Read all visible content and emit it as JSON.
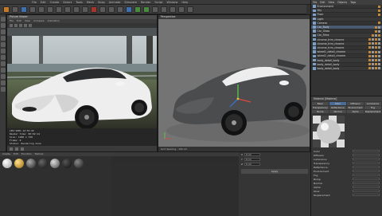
{
  "app": {
    "title": "CINEMA 4D"
  },
  "menubar": {
    "items": [
      "File",
      "Edit",
      "Create",
      "Select",
      "Tools",
      "Mesh",
      "Snap",
      "Animate",
      "Simulate",
      "Render",
      "Script",
      "Window",
      "Help"
    ]
  },
  "render_window": {
    "title": "Picture Viewer",
    "menu": [
      "File",
      "Edit",
      "View",
      "Compare",
      "Animation"
    ],
    "info_lines": [
      "CPU:100%  12:35:22",
      "Render time: 00:02:14",
      "Size: 1280 x 720",
      "Frame: 0",
      "Status: Rendering done"
    ]
  },
  "viewport": {
    "title": "Perspective",
    "footer": "Grid Spacing : 100 cm"
  },
  "object_manager": {
    "tabs": [
      "File",
      "Edit",
      "View",
      "Objects",
      "Tags"
    ],
    "rows": [
      {
        "label": "Environment",
        "tags": 1
      },
      {
        "label": "Sky",
        "tags": 1
      },
      {
        "label": "Floor",
        "tags": 1
      },
      {
        "label": "Light",
        "tags": 0
      },
      {
        "label": "Camera",
        "tags": 1
      },
      {
        "label": "Car_Body",
        "tags": 2
      },
      {
        "label": "Car_Glass",
        "tags": 2
      },
      {
        "label": "Car_Rims",
        "tags": 3
      },
      {
        "label": "chrome_trim_chrome",
        "tags": 4
      },
      {
        "label": "chrome_trim_chrome",
        "tags": 4
      },
      {
        "label": "chrome_trim_chrome",
        "tags": 4
      },
      {
        "label": "wheel1_detail_chrome",
        "tags": 4
      },
      {
        "label": "wheel2_detail_chrome",
        "tags": 4
      },
      {
        "label": "body_detail_body",
        "tags": 4
      },
      {
        "label": "body_detail_body",
        "tags": 4
      },
      {
        "label": "body_detail_body",
        "tags": 4
      }
    ]
  },
  "attribute_manager": {
    "title": "Material [Material]",
    "tabs": [
      "Basic",
      "Color",
      "Diffusion",
      "Luminance",
      "Transparency",
      "Reflectance",
      "Environment",
      "Fog",
      "Bump",
      "Normal",
      "Alpha",
      "Displacement"
    ],
    "active_tab": 1,
    "props": [
      "Color",
      "Diffusion",
      "Luminance",
      "Transparency",
      "Reflectance",
      "Environment",
      "Fog",
      "Bump",
      "Normal",
      "Alpha",
      "Glow",
      "Displacement"
    ]
  },
  "material_manager": {
    "menu": [
      "Create",
      "Edit",
      "Function",
      "Texture"
    ]
  },
  "coordinates": {
    "rows": [
      {
        "axis": "X",
        "val": "0 cm"
      },
      {
        "axis": "Y",
        "val": "0 cm"
      },
      {
        "axis": "Z",
        "val": "0 cm"
      }
    ],
    "apply": "Apply"
  },
  "colors": {
    "accent": "#4b6c94",
    "car_white": "#f2f2f2",
    "car_grey": "#4b4d4f"
  }
}
